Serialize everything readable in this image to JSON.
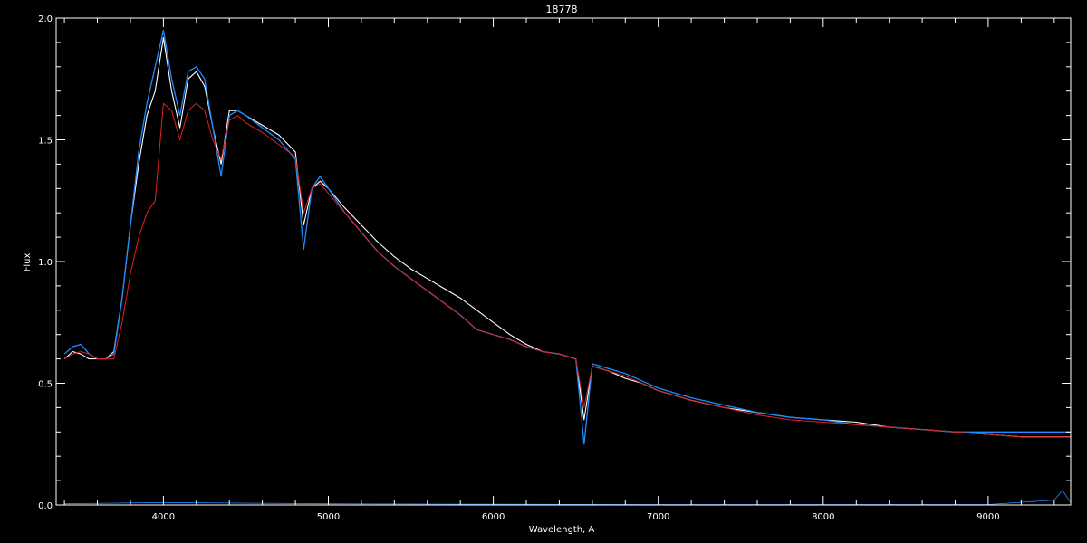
{
  "chart_data": {
    "type": "line",
    "title": "18778",
    "xlabel": "Wavelength, A",
    "ylabel": "Flux",
    "xlim": [
      3350,
      9500
    ],
    "ylim": [
      0,
      2.0
    ],
    "x_ticks": [
      "4000",
      "5000",
      "6000",
      "7000",
      "8000",
      "9000"
    ],
    "y_ticks": [
      "0.0",
      "0.5",
      "1.0",
      "1.5",
      "2.0"
    ],
    "grid": false,
    "legend": "none",
    "colors": {
      "background": "#000000",
      "axes": "#ffffff",
      "observed": "#ffffff",
      "model": "#1e8cff",
      "fit": "#e02020"
    },
    "series": [
      {
        "x": [
          3400,
          3450,
          3500,
          3550,
          3600,
          3650,
          3700,
          3750,
          3800,
          3850,
          3900,
          3950,
          4000,
          4050,
          4100,
          4150,
          4200,
          4250,
          4300,
          4350,
          4400,
          4450,
          4500,
          4600,
          4700,
          4800,
          4850,
          4900,
          4950,
          5000,
          5100,
          5200,
          5300,
          5400,
          5500,
          5600,
          5700,
          5800,
          5900,
          6000,
          6100,
          6200,
          6300,
          6400,
          6500,
          6550,
          6600,
          6700,
          6800,
          6900,
          7000,
          7200,
          7400,
          7600,
          7800,
          8000,
          8200,
          8400,
          8600,
          8800,
          9000,
          9200,
          9400,
          9500
        ],
        "values": [
          0.6,
          0.63,
          0.62,
          0.6,
          0.6,
          0.6,
          0.63,
          0.85,
          1.15,
          1.4,
          1.6,
          1.7,
          1.92,
          1.7,
          1.55,
          1.75,
          1.78,
          1.72,
          1.55,
          1.4,
          1.62,
          1.62,
          1.6,
          1.56,
          1.52,
          1.45,
          1.15,
          1.3,
          1.33,
          1.3,
          1.22,
          1.15,
          1.08,
          1.02,
          0.97,
          0.93,
          0.89,
          0.85,
          0.8,
          0.75,
          0.7,
          0.66,
          0.63,
          0.62,
          0.6,
          0.35,
          0.57,
          0.55,
          0.52,
          0.5,
          0.47,
          0.43,
          0.4,
          0.38,
          0.36,
          0.35,
          0.34,
          0.32,
          0.31,
          0.3,
          0.29,
          0.28,
          0.28,
          0.28
        ]
      },
      {
        "x": [
          3400,
          3450,
          3500,
          3550,
          3600,
          3650,
          3700,
          3750,
          3800,
          3850,
          3900,
          3950,
          4000,
          4050,
          4100,
          4150,
          4200,
          4250,
          4300,
          4350,
          4400,
          4450,
          4500,
          4600,
          4700,
          4800,
          4850,
          4900,
          4950,
          5000,
          5100,
          5200,
          5300,
          5400,
          5500,
          5600,
          5700,
          5800,
          5900,
          6000,
          6100,
          6200,
          6300,
          6400,
          6500,
          6550,
          6600,
          6700,
          6800,
          6900,
          7000,
          7200,
          7400,
          7600,
          7800,
          8000,
          8200,
          8400,
          8600,
          8800,
          9000,
          9200,
          9400,
          9500
        ],
        "values": [
          0.62,
          0.65,
          0.66,
          0.62,
          0.6,
          0.6,
          0.62,
          0.85,
          1.15,
          1.45,
          1.65,
          1.8,
          1.95,
          1.75,
          1.6,
          1.78,
          1.8,
          1.75,
          1.55,
          1.35,
          1.6,
          1.62,
          1.6,
          1.55,
          1.5,
          1.42,
          1.05,
          1.3,
          1.35,
          1.3,
          1.2,
          1.12,
          1.04,
          0.98,
          0.93,
          0.88,
          0.83,
          0.78,
          0.72,
          0.7,
          0.68,
          0.65,
          0.63,
          0.62,
          0.6,
          0.25,
          0.58,
          0.56,
          0.54,
          0.51,
          0.48,
          0.44,
          0.41,
          0.38,
          0.36,
          0.35,
          0.33,
          0.32,
          0.31,
          0.3,
          0.3,
          0.3,
          0.3,
          0.3
        ]
      },
      {
        "x": [
          3400,
          3450,
          3500,
          3550,
          3600,
          3650,
          3700,
          3750,
          3800,
          3850,
          3900,
          3950,
          4000,
          4050,
          4100,
          4150,
          4200,
          4250,
          4300,
          4350,
          4400,
          4450,
          4500,
          4600,
          4700,
          4800,
          4850,
          4900,
          4950,
          5000,
          5100,
          5200,
          5300,
          5400,
          5500,
          5600,
          5700,
          5800,
          5900,
          6000,
          6100,
          6200,
          6300,
          6400,
          6500,
          6550,
          6600,
          6700,
          6800,
          6900,
          7000,
          7200,
          7400,
          7600,
          7800,
          8000,
          8200,
          8400,
          8600,
          8800,
          9000,
          9200,
          9400,
          9500
        ],
        "values": [
          0.6,
          0.62,
          0.63,
          0.62,
          0.6,
          0.6,
          0.6,
          0.75,
          0.95,
          1.1,
          1.2,
          1.25,
          1.65,
          1.62,
          1.5,
          1.62,
          1.65,
          1.62,
          1.5,
          1.42,
          1.58,
          1.6,
          1.57,
          1.53,
          1.48,
          1.43,
          1.2,
          1.3,
          1.32,
          1.28,
          1.2,
          1.12,
          1.04,
          0.98,
          0.93,
          0.88,
          0.83,
          0.78,
          0.72,
          0.7,
          0.68,
          0.65,
          0.63,
          0.62,
          0.6,
          0.4,
          0.57,
          0.55,
          0.53,
          0.5,
          0.47,
          0.43,
          0.4,
          0.37,
          0.35,
          0.34,
          0.33,
          0.32,
          0.31,
          0.3,
          0.29,
          0.28,
          0.28,
          0.28
        ]
      },
      {
        "x": [
          3400,
          4000,
          5000,
          6000,
          7000,
          8000,
          9000,
          9400,
          9450,
          9500
        ],
        "values": [
          0.005,
          0.01,
          0.005,
          0.003,
          0.002,
          0.002,
          0.002,
          0.02,
          0.06,
          0.01
        ]
      }
    ]
  }
}
